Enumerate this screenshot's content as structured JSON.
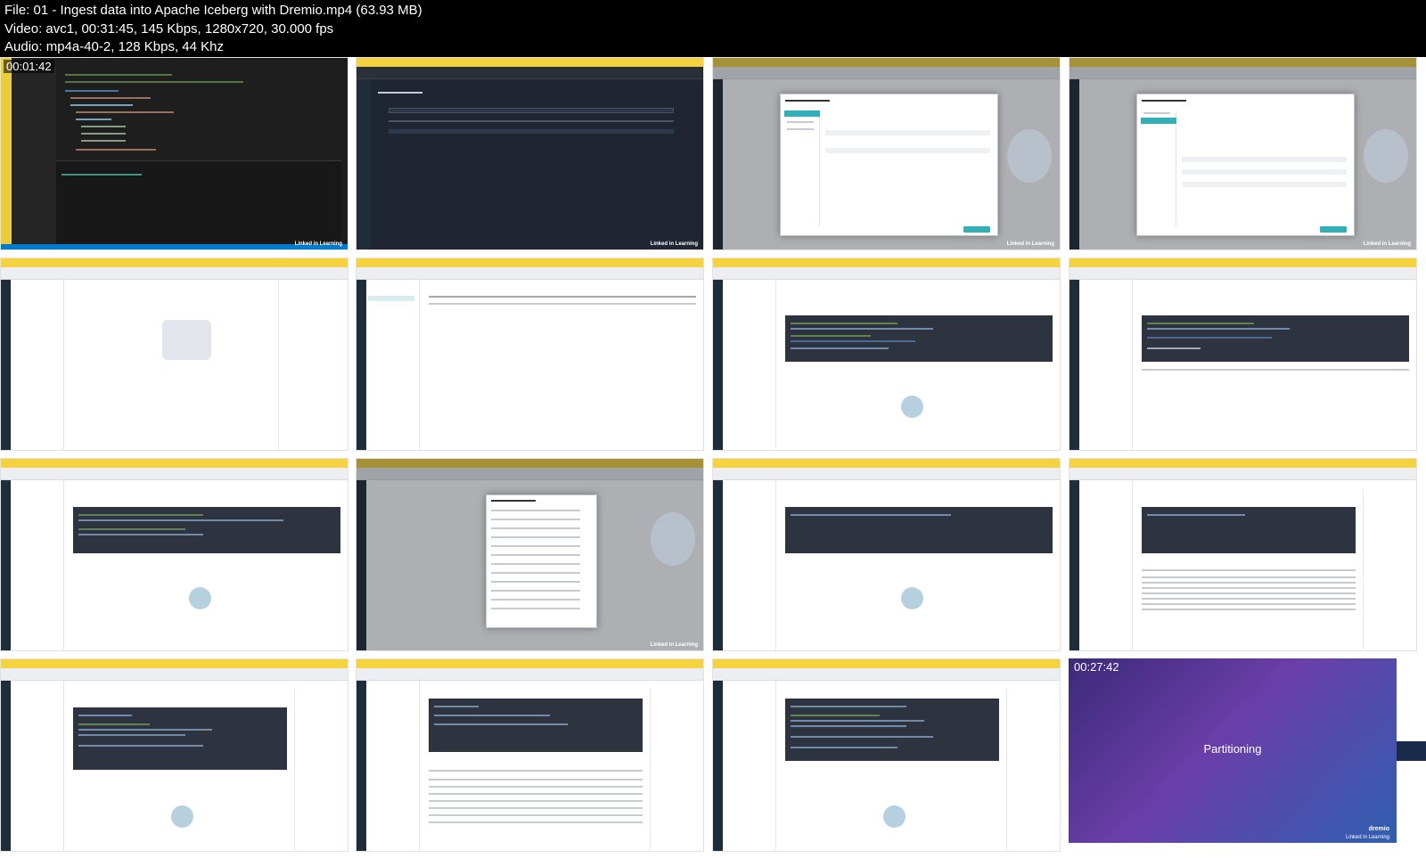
{
  "header": {
    "file_line": "File: 01 - Ingest data into Apache Iceberg with Dremio.mp4 (63.93 MB)",
    "video_line": "Video: avc1, 00:31:45, 145 Kbps, 1280x720, 30.000 fps",
    "audio_line": "Audio: mp4a-40-2, 128 Kbps, 44 Khz"
  },
  "thumbnails": [
    {
      "timestamp": "00:01:42",
      "scene": "vscode-docker-compose"
    },
    {
      "timestamp": "",
      "scene": "object-browser"
    },
    {
      "timestamp": "",
      "scene": "new-nessie-source-general"
    },
    {
      "timestamp": "",
      "scene": "new-nessie-source-storage"
    },
    {
      "timestamp": "",
      "scene": "datasets-empty"
    },
    {
      "timestamp": "",
      "scene": "settings-node-activity"
    },
    {
      "timestamp": "",
      "scene": "sql-runner-create-table"
    },
    {
      "timestamp": "",
      "scene": "sql-runner-insert"
    },
    {
      "timestamp": "",
      "scene": "sql-runner-copy-into"
    },
    {
      "timestamp": "",
      "scene": "add-data-source"
    },
    {
      "timestamp": "",
      "scene": "sql-runner-select"
    },
    {
      "timestamp": "",
      "scene": "sql-runner-results"
    },
    {
      "timestamp": "",
      "scene": "sql-runner-ctas"
    },
    {
      "timestamp": "",
      "scene": "sql-runner-results-2"
    },
    {
      "timestamp": "",
      "scene": "sql-runner-partition"
    },
    {
      "timestamp": "00:27:42",
      "scene": "partitioning-slide"
    }
  ],
  "slide": {
    "title": "Partitioning",
    "brand": "dremio",
    "footer": "Linked in Learning"
  },
  "watermark": "Linked in Learning"
}
